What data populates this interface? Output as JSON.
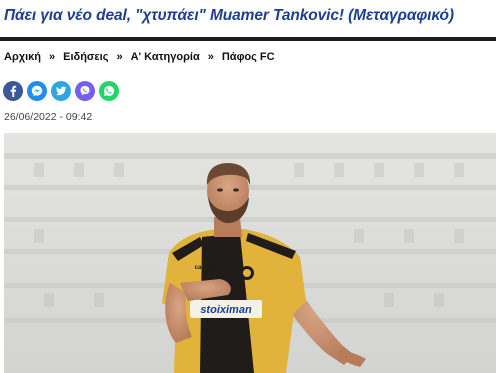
{
  "article": {
    "title": "Πάει για νέο deal, \"χτυπάει\" Muamer Tankovic! (Μεταγραφικό)",
    "date": "26/06/2022 - 09:42"
  },
  "breadcrumb": {
    "items": [
      "Αρχική",
      "Ειδήσεις",
      "Α' Κατηγορία",
      "Πάφος FC"
    ],
    "separator": "»"
  },
  "share": [
    {
      "icon": "facebook-icon",
      "color": "#3b5998",
      "glyph": "f"
    },
    {
      "icon": "messenger-icon",
      "color": "#1f8ef1",
      "glyph": "m"
    },
    {
      "icon": "twitter-icon",
      "color": "#2fa6e3",
      "glyph": "t"
    },
    {
      "icon": "viber-icon",
      "color": "#7360f2",
      "glyph": "v"
    },
    {
      "icon": "whatsapp-icon",
      "color": "#25d366",
      "glyph": "w"
    }
  ],
  "photo": {
    "jersey_sponsor": "stoiximan",
    "jersey_brand": "capelli",
    "colors": {
      "jersey_yellow": "#e2b33a",
      "jersey_black": "#1f1c1a",
      "accent_blue": "#1d3f91"
    }
  }
}
